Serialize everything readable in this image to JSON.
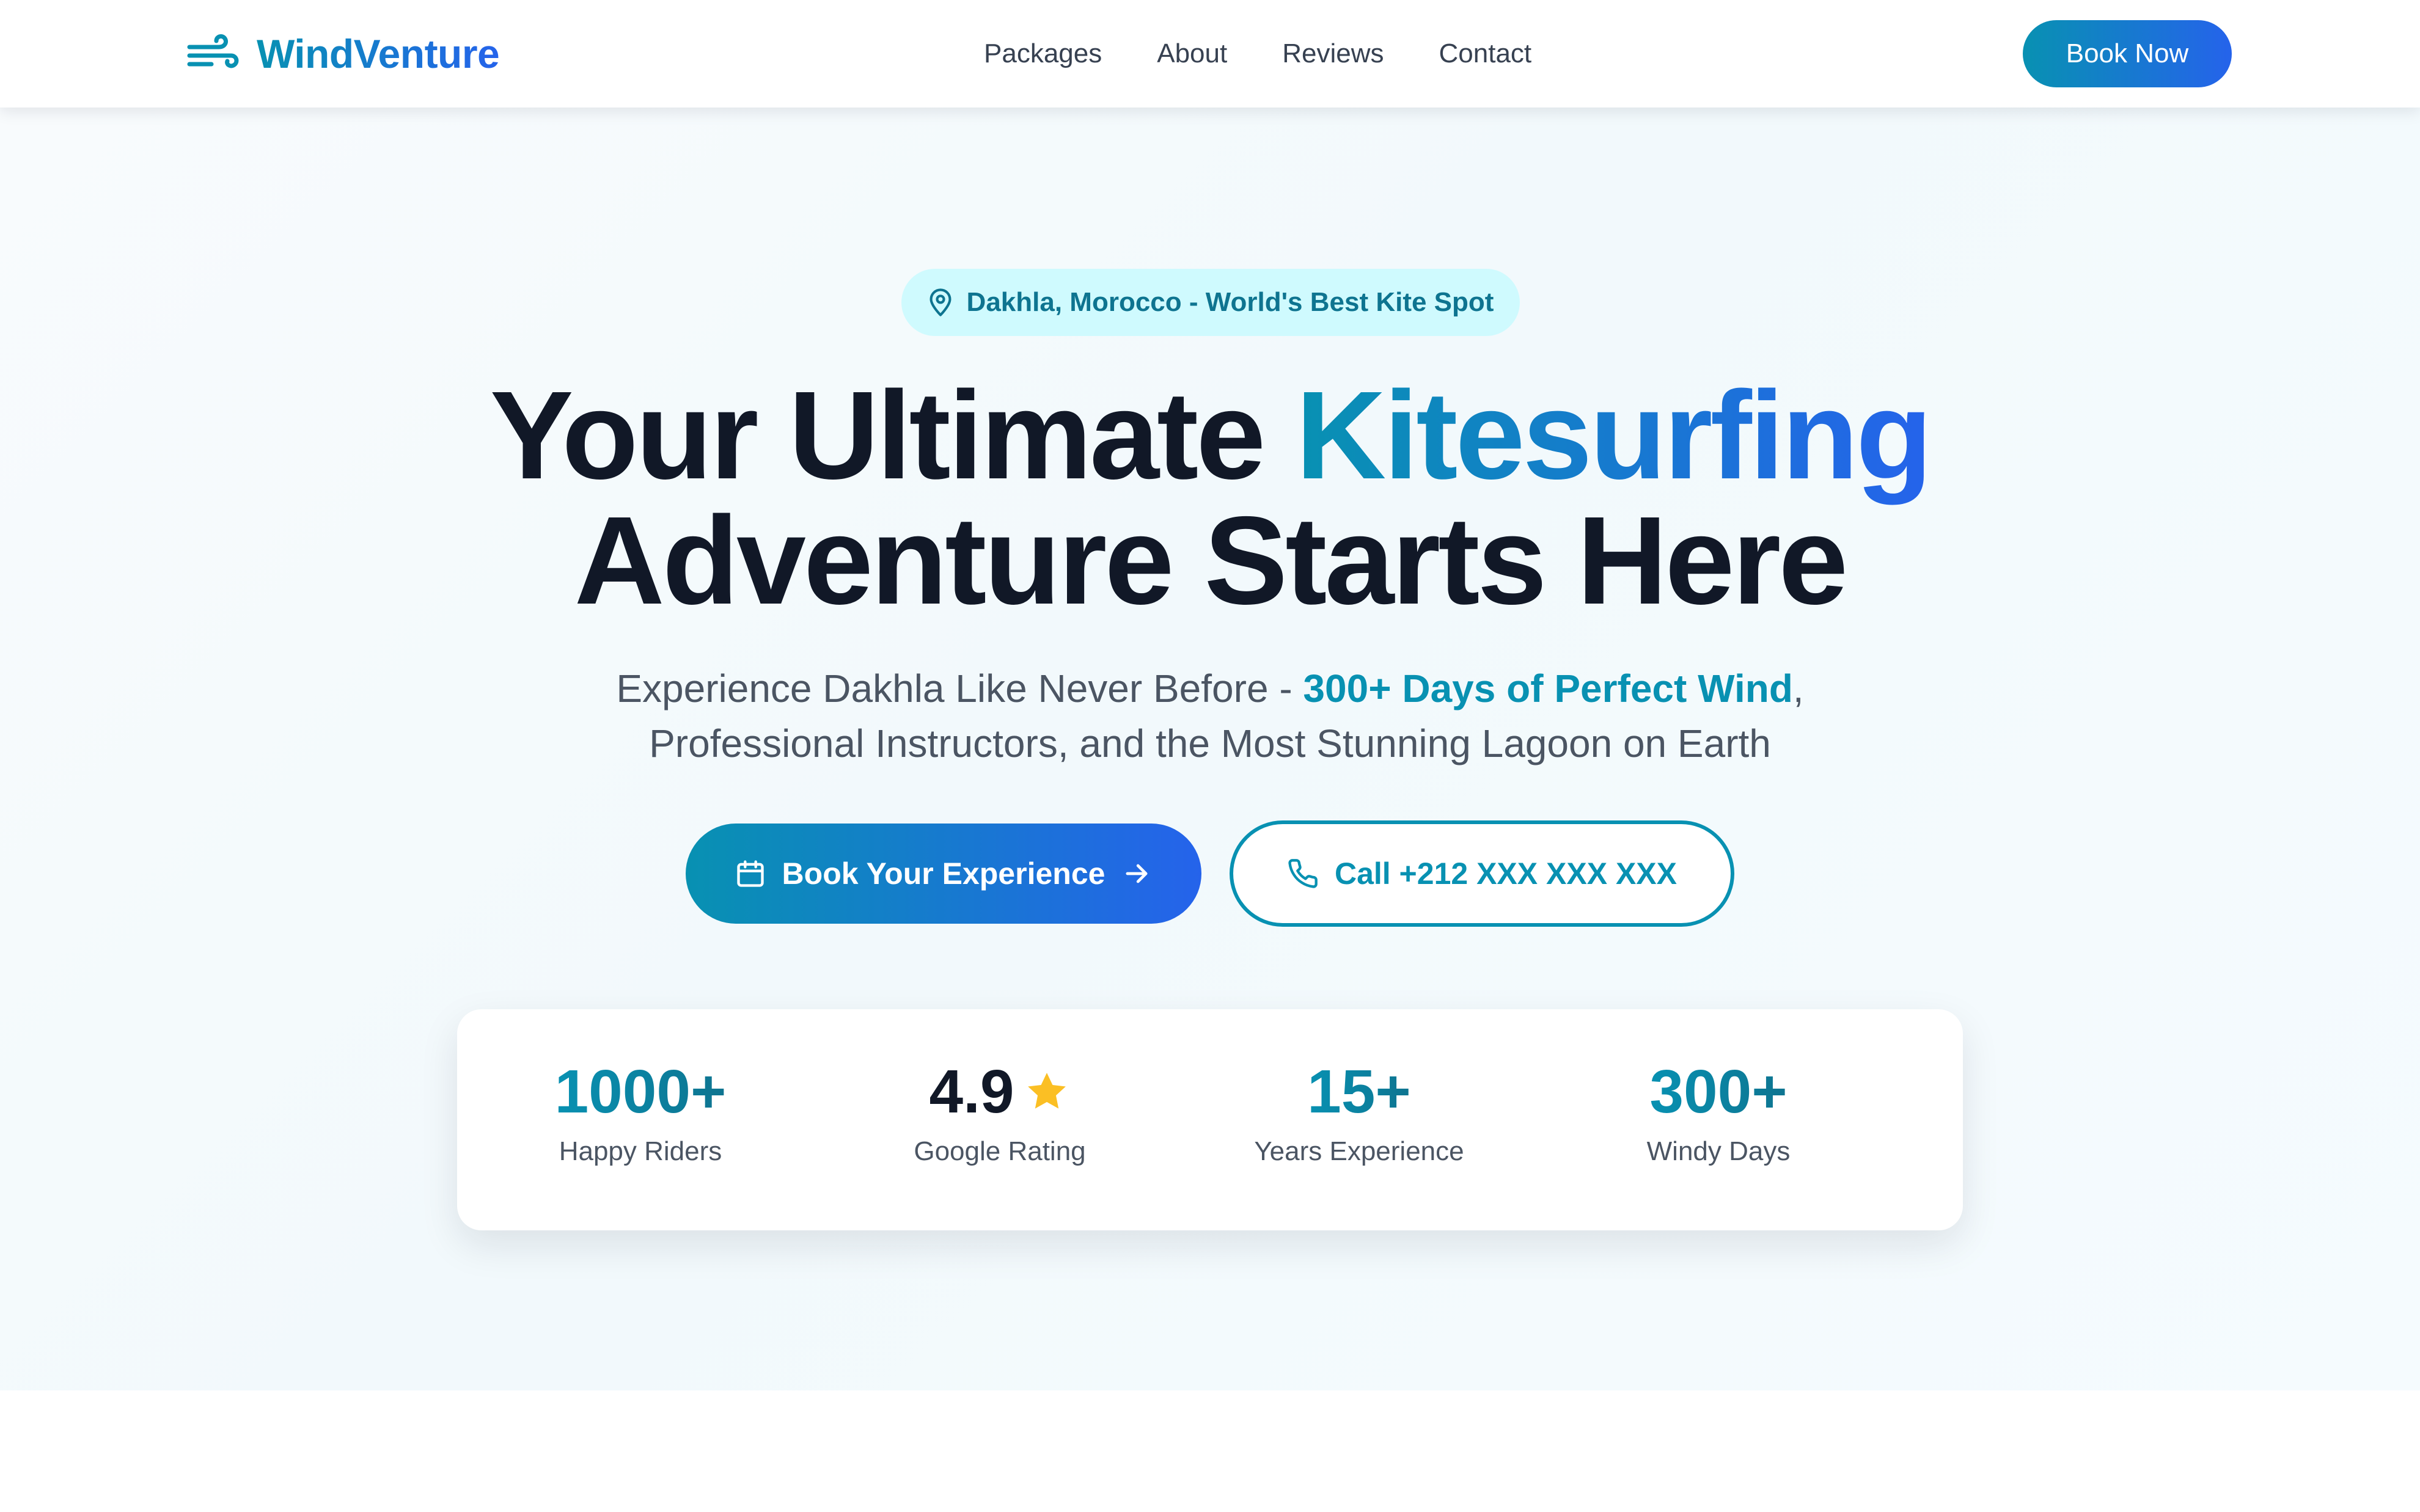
{
  "brand": {
    "name": "WindVenture",
    "icon": "wind-icon",
    "colors": {
      "primary": "#0891b2",
      "secondary": "#2563eb",
      "star": "#fbbf24"
    }
  },
  "nav": {
    "items": [
      {
        "label": "Packages"
      },
      {
        "label": "About"
      },
      {
        "label": "Reviews"
      },
      {
        "label": "Contact"
      }
    ],
    "cta_label": "Book Now"
  },
  "hero": {
    "badge": {
      "icon": "map-pin-icon",
      "text": "Dakhla, Morocco - World's Best Kite Spot"
    },
    "headline": {
      "line1_plain": "Your Ultimate ",
      "line1_accent": "Kitesurfing",
      "line2": "Adventure Starts Here"
    },
    "subhead": {
      "part1": "Experience Dakhla Like Never Before - ",
      "highlight": "300+ Days of Perfect Wind",
      "part2": ",",
      "line2": "Professional Instructors, and the Most Stunning Lagoon on Earth"
    },
    "primary_button": {
      "label": "Book Your Experience",
      "icon": "calendar-icon",
      "trailing_icon": "arrow-right-icon"
    },
    "secondary_button": {
      "label": "Call +212 XXX XXX XXX",
      "icon": "phone-icon"
    }
  },
  "stats": [
    {
      "value": "1000+",
      "label": "Happy Riders"
    },
    {
      "value": "4.9",
      "label": "Google Rating",
      "icon": "star-icon"
    },
    {
      "value": "15+",
      "label": "Years Experience"
    },
    {
      "value": "300+",
      "label": "Windy Days"
    }
  ]
}
